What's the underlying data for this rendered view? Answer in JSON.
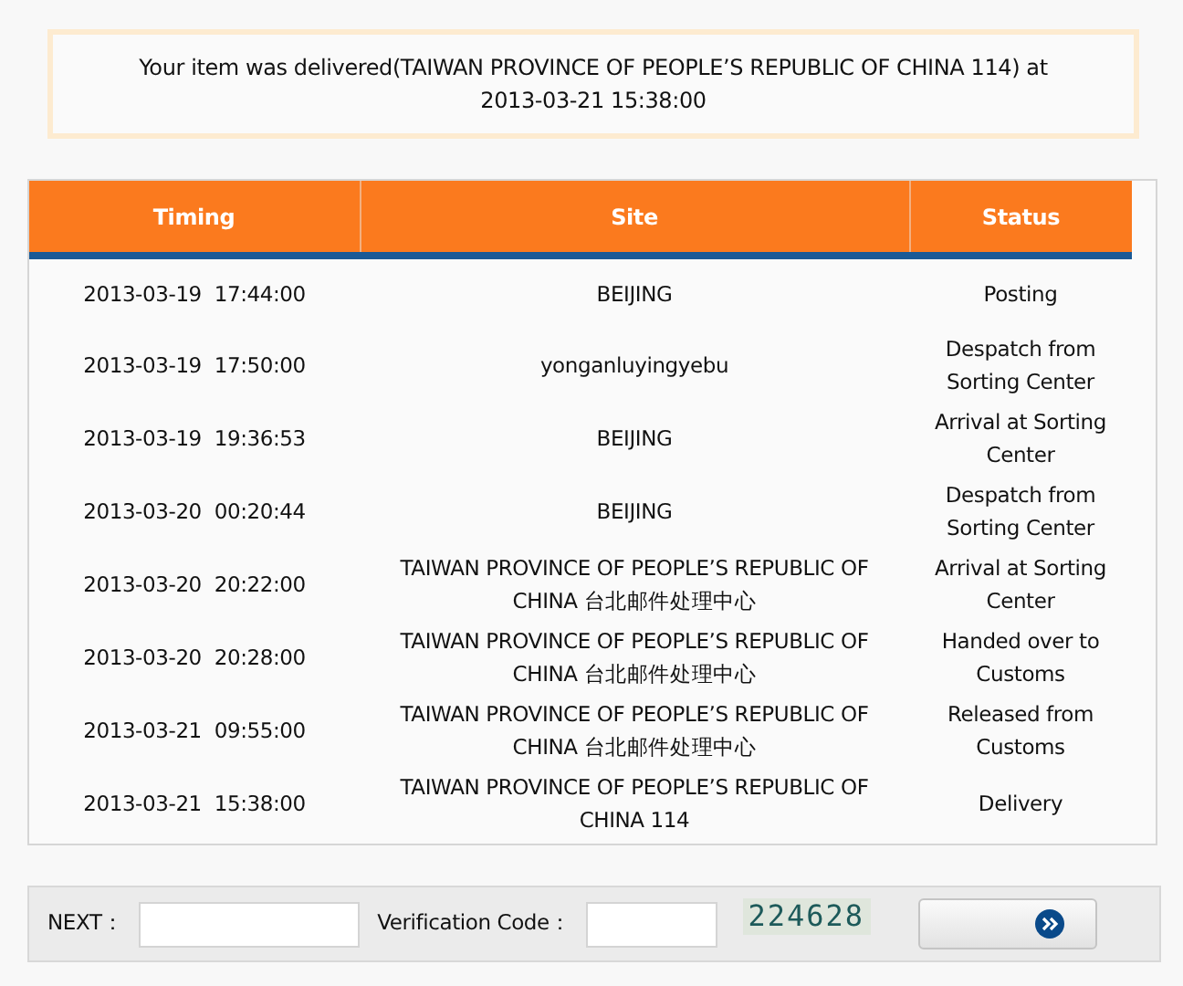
{
  "notice": "Your item was delivered(TAIWAN PROVINCE OF PEOPLE’S REPUBLIC OF CHINA 114) at 2013-03-21 15:38:00",
  "table": {
    "columns": [
      "Timing",
      "Site",
      "Status"
    ],
    "rows": [
      {
        "timing": "2013-03-19  17:44:00",
        "site": "BEIJING",
        "status": "Posting"
      },
      {
        "timing": "2013-03-19  17:50:00",
        "site": "yonganluyingyebu",
        "status": "Despatch from Sorting Center"
      },
      {
        "timing": "2013-03-19  19:36:53",
        "site": "BEIJING",
        "status": "Arrival at Sorting Center"
      },
      {
        "timing": "2013-03-20  00:20:44",
        "site": "BEIJING",
        "status": "Despatch from Sorting Center"
      },
      {
        "timing": "2013-03-20  20:22:00",
        "site": "TAIWAN PROVINCE OF PEOPLE’S REPUBLIC OF CHINA 台北邮件处理中心",
        "status": "Arrival at Sorting Center"
      },
      {
        "timing": "2013-03-20  20:28:00",
        "site": "TAIWAN PROVINCE OF PEOPLE’S REPUBLIC OF CHINA 台北邮件处理中心",
        "status": "Handed over to Customs"
      },
      {
        "timing": "2013-03-21  09:55:00",
        "site": "TAIWAN PROVINCE OF PEOPLE’S REPUBLIC OF CHINA 台北邮件处理中心",
        "status": "Released from Customs"
      },
      {
        "timing": "2013-03-21  15:38:00",
        "site": "TAIWAN PROVINCE OF PEOPLE’S REPUBLIC OF CHINA 114",
        "status": "Delivery"
      }
    ]
  },
  "form": {
    "next_label": "NEXT：",
    "code_label": "Verification Code：",
    "captcha": "224628"
  }
}
